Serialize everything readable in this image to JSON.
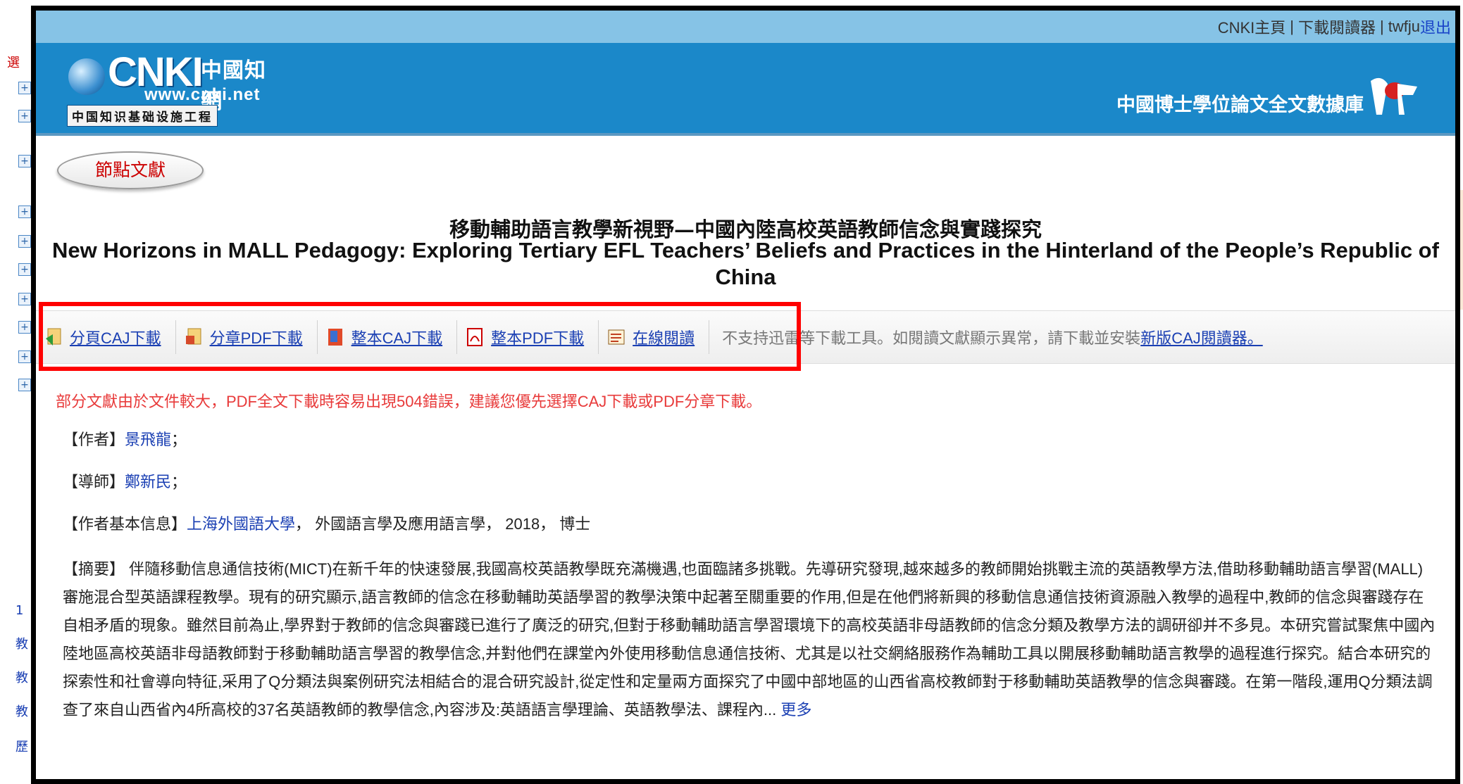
{
  "background": {
    "left_fragments": [
      "選",
      "1",
      "教",
      "教",
      "教",
      "歷"
    ]
  },
  "topbar": {
    "home_link": "CNKI主頁",
    "separator": "|",
    "reader_link": "下載閱讀器",
    "user": "twfju",
    "logout": "退出"
  },
  "banner": {
    "logo_cnki": "CNKI",
    "logo_cn": "中國知網",
    "logo_url": "www.cnki.net",
    "logo_sub": "中国知识基础设施工程",
    "db_title": "中國博士學位論文全文數據庫"
  },
  "node_button": "節點文獻",
  "title": {
    "zh": "移動輔助語言教學新視野—中國內陸高校英語教師信念與實踐探究",
    "en": "New Horizons in MALL Pedagogy: Exploring Tertiary EFL Teachers’ Beliefs and Practices in the Hinterland of the People’s Republic of China"
  },
  "toolbar": {
    "items": [
      {
        "label": "分頁CAJ下載",
        "icon": "caj-page-icon"
      },
      {
        "label": "分章PDF下載",
        "icon": "pdf-chapter-icon"
      },
      {
        "label": "整本CAJ下載",
        "icon": "caj-book-icon"
      },
      {
        "label": "整本PDF下載",
        "icon": "pdf-book-icon"
      },
      {
        "label": "在線閱讀",
        "icon": "online-read-icon"
      }
    ],
    "note": "不支持迅雷等下載工具。如閱讀文獻顯示異常，請下載並安裝",
    "note_link": "新版CAJ閱讀器。"
  },
  "notice": "部分文獻由於文件較大，PDF全文下載時容易出現504錯誤，建議您優先選擇CAJ下載或PDF分章下載。",
  "author": {
    "label": "【作者】",
    "value": "景飛龍",
    "suffix": "；"
  },
  "advisor": {
    "label": "【導師】",
    "value": "鄭新民",
    "suffix": "；"
  },
  "author_info": {
    "label": "【作者基本信息】",
    "school": "上海外國語大學",
    "rest": "， 外國語言學及應用語言學， 2018， 博士"
  },
  "abstract": {
    "label": "【摘要】",
    "text": " 伴隨移動信息通信技術(MICT)在新千年的快速發展,我國高校英語教學既充滿機遇,也面臨諸多挑戰。先導研究發現,越來越多的教師開始挑戰主流的英語教學方法,借助移動輔助語言學習(MALL)審施混合型英語課程教學。現有的研究顯示,語言教師的信念在移動輔助英語學習的教學決策中起著至關重要的作用,但是在他們將新興的移動信息通信技術資源融入教學的過程中,教師的信念與審踐存在自相矛盾的現象。雖然目前為止,學界對于教師的信念與審踐已進行了廣泛的研究,但對于移動輔助語言學習環境下的高校英語非母語教師的信念分類及教學方法的調研卻并不多見。本研究嘗試聚焦中國內陸地區高校英語非母語教師對于移動輔助語言學習的教學信念,并對他們在課堂內外使用移動信息通信技術、尤其是以社交網絡服務作為輔助工具以開展移動輔助語言教學的過程進行探究。結合本研究的探索性和社會導向特征,采用了Q分類法與案例研究法相結合的混合研究設計,從定性和定量兩方面探究了中國中部地區的山西省高校教師對于移動輔助英語教學的信念與審踐。在第一階段,運用Q分類法調查了來自山西省內4所高校的37名英語教師的教學信念,內容涉及:英語語言學理論、英語教學法、課程內...",
    "more": "更多"
  }
}
